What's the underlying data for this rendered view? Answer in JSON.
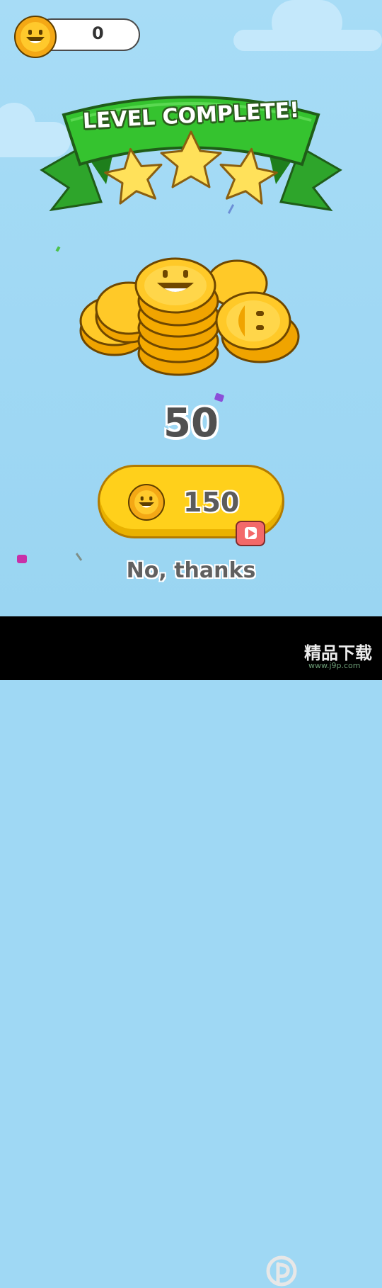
{
  "header": {
    "coin_count": "0",
    "coin_icon": "smiling-coin-icon"
  },
  "level_complete": {
    "title": "LEVEL COMPLETE!",
    "stars_earned": 3,
    "stars_total": 3
  },
  "reward": {
    "amount": "50",
    "coin_pile_icon": "coin-pile-icon"
  },
  "bonus_offer": {
    "amount": "150",
    "icon": "smiling-coin-icon",
    "ad_icon": "video-ad-icon"
  },
  "decline": {
    "label": "No, thanks"
  },
  "watermark": {
    "main": "精品下载",
    "sub": "www.j9p.com"
  },
  "colors": {
    "sky": "#9fd8f4",
    "ribbon": "#31b52d",
    "coin": "#ffc92c",
    "button": "#ffd01b",
    "ad": "#f36969"
  }
}
